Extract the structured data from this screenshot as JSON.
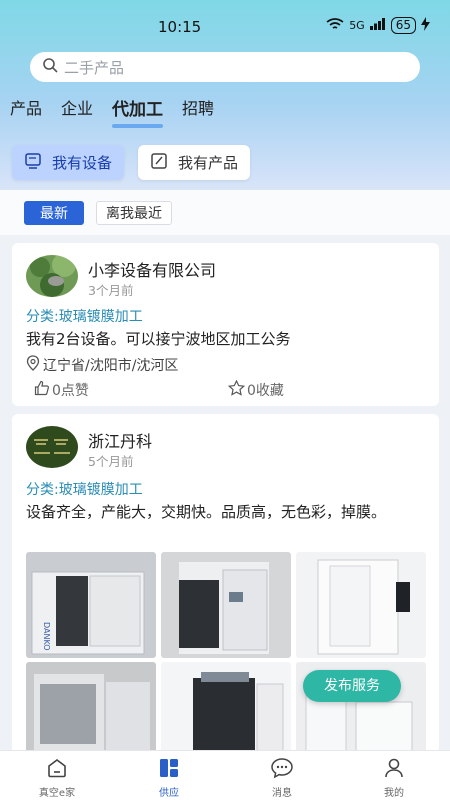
{
  "status": {
    "time": "10:15",
    "network": "5G",
    "battery": "65"
  },
  "search": {
    "placeholder": "二手产品"
  },
  "tabs": [
    {
      "label": "产品"
    },
    {
      "label": "企业"
    },
    {
      "label": "代加工",
      "active": true
    },
    {
      "label": "招聘"
    }
  ],
  "switches": {
    "equipment": "我有设备",
    "product": "我有产品"
  },
  "filters": {
    "latest": "最新",
    "nearby": "离我最近"
  },
  "posts": [
    {
      "company": "小李设备有限公司",
      "time": "3个月前",
      "category": "分类:玻璃镀膜加工",
      "description": "我有2台设备。可以接宁波地区加工公务",
      "location": "辽宁省/沈阳市/沈河区",
      "likes": "0点赞",
      "favorites": "0收藏"
    },
    {
      "company": "浙江丹科",
      "time": "5个月前",
      "category": "分类:玻璃镀膜加工",
      "description": "设备齐全，产能大，交期快。品质高，无色彩，掉膜。",
      "photo_brand": "DANKO"
    }
  ],
  "publish_button": "发布服务",
  "bottom_nav": [
    {
      "label": "真空e家",
      "icon": "home-icon"
    },
    {
      "label": "供应",
      "icon": "grid-icon",
      "active": true
    },
    {
      "label": "消息",
      "icon": "chat-icon"
    },
    {
      "label": "我的",
      "icon": "user-icon"
    }
  ],
  "colors": {
    "accent": "#2b64d6",
    "category": "#2a8db5",
    "publish": "#2fb7a6"
  }
}
